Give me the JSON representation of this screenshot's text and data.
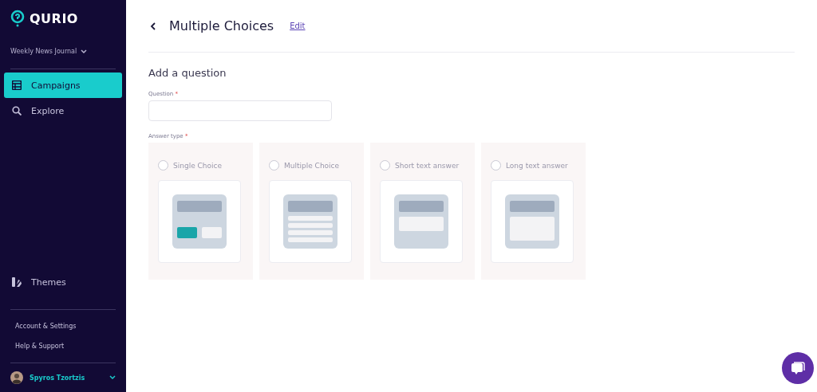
{
  "brand": "QURIO",
  "workspace": "Weekly News Journal",
  "nav": [
    {
      "label": "Campaigns",
      "kind": "table",
      "selected": true
    },
    {
      "label": "Explore",
      "kind": "search",
      "selected": false
    }
  ],
  "bottom_nav": [
    {
      "label": "Themes",
      "kind": "themes",
      "selected": false
    }
  ],
  "links": [
    "Account & Settings",
    "Help & Support"
  ],
  "user": "Spyros Tzortzis",
  "page": {
    "title": "Multiple Choices",
    "edit_link": "Edit"
  },
  "section_title": "Add a question",
  "question": {
    "label": "Question",
    "required_mark": "*"
  },
  "answer_type": {
    "label": "Answer type",
    "required_mark": "*",
    "options": [
      {
        "label": "Single Choice",
        "kind": "single",
        "selected": false
      },
      {
        "label": "Multiple Choice",
        "kind": "multiple",
        "selected": false
      },
      {
        "label": "Short text answer",
        "kind": "short",
        "selected": false
      },
      {
        "label": "Long text answer",
        "kind": "long",
        "selected": false
      }
    ]
  }
}
